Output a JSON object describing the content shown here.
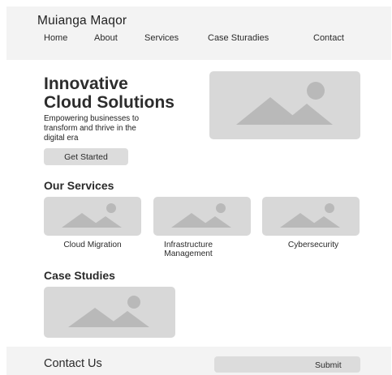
{
  "header": {
    "brand": "Muianga Maqor",
    "nav": [
      "Home",
      "About",
      "Services",
      "Case Sturadies",
      "Contact"
    ]
  },
  "hero": {
    "title_line1": "Innovative",
    "title_line2": "Cloud Solutions",
    "subtitle_line1": "Empowering businesses to",
    "subtitle_line2": "transform and thrive in the",
    "subtitle_line3": "digital era",
    "cta_label": "Get Started",
    "image_icon": "image-placeholder-icon"
  },
  "services": {
    "title": "Our Services",
    "items": [
      {
        "label_line1": "Cloud Migration",
        "label_line2": ""
      },
      {
        "label_line1": "Infrastructure",
        "label_line2": "Management"
      },
      {
        "label_line1": "Cybersecurity",
        "label_line2": ""
      }
    ]
  },
  "case_studies": {
    "title": "Case Studies"
  },
  "contact": {
    "title": "Contact Us",
    "submit_label": "Submit"
  },
  "colors": {
    "placeholder_bg": "#d8d8d8",
    "placeholder_shape": "#b9b9b9",
    "band_bg": "#f3f3f3",
    "button_bg": "#dcdcdc"
  }
}
